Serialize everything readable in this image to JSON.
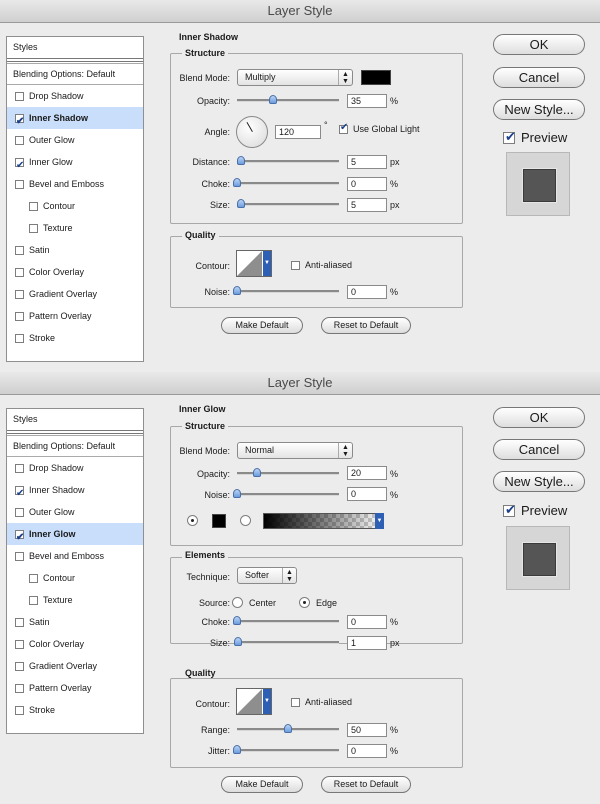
{
  "app_title": "Layer Style",
  "styles_header": "Styles",
  "blending_options": "Blending Options: Default",
  "style_items": [
    {
      "label": "Drop Shadow",
      "sub": false
    },
    {
      "label": "Inner Shadow",
      "sub": false
    },
    {
      "label": "Outer Glow",
      "sub": false
    },
    {
      "label": "Inner Glow",
      "sub": false
    },
    {
      "label": "Bevel and Emboss",
      "sub": false
    },
    {
      "label": "Contour",
      "sub": true
    },
    {
      "label": "Texture",
      "sub": true
    },
    {
      "label": "Satin",
      "sub": false
    },
    {
      "label": "Color Overlay",
      "sub": false
    },
    {
      "label": "Gradient Overlay",
      "sub": false
    },
    {
      "label": "Pattern Overlay",
      "sub": false
    },
    {
      "label": "Stroke",
      "sub": false
    }
  ],
  "buttons": {
    "ok": "OK",
    "cancel": "Cancel",
    "new_style": "New Style...",
    "preview": "Preview",
    "make_default": "Make Default",
    "reset_default": "Reset to Default"
  },
  "colors": {
    "accent": "#2d5fb5",
    "selection": "#c8defa",
    "swatch": "#000000"
  },
  "common": {
    "blend_mode": "Blend Mode:",
    "opacity": "Opacity:",
    "noise": "Noise:",
    "choke": "Choke:",
    "size": "Size:",
    "contour": "Contour:",
    "anti_aliased": "Anti-aliased",
    "quality": "Quality",
    "structure": "Structure",
    "pct": "%",
    "px": "px"
  },
  "inner_shadow": {
    "section": "Inner Shadow",
    "selected_index": 1,
    "checked": [
      1,
      3
    ],
    "blend_mode": "Multiply",
    "opacity": "35",
    "angle_label": "Angle:",
    "angle": "120",
    "degree": "°",
    "use_global_light": "Use Global Light",
    "distance_label": "Distance:",
    "distance": "5",
    "choke": "0",
    "size": "5",
    "noise": "0"
  },
  "inner_glow": {
    "section": "Inner Glow",
    "selected_index": 3,
    "checked": [
      1,
      3
    ],
    "blend_mode": "Normal",
    "opacity": "20",
    "noise": "0",
    "elements": "Elements",
    "technique_label": "Technique:",
    "technique": "Softer",
    "source_label": "Source:",
    "center": "Center",
    "edge": "Edge",
    "choke": "0",
    "size": "1",
    "range_label": "Range:",
    "range": "50",
    "jitter_label": "Jitter:",
    "jitter": "0"
  }
}
